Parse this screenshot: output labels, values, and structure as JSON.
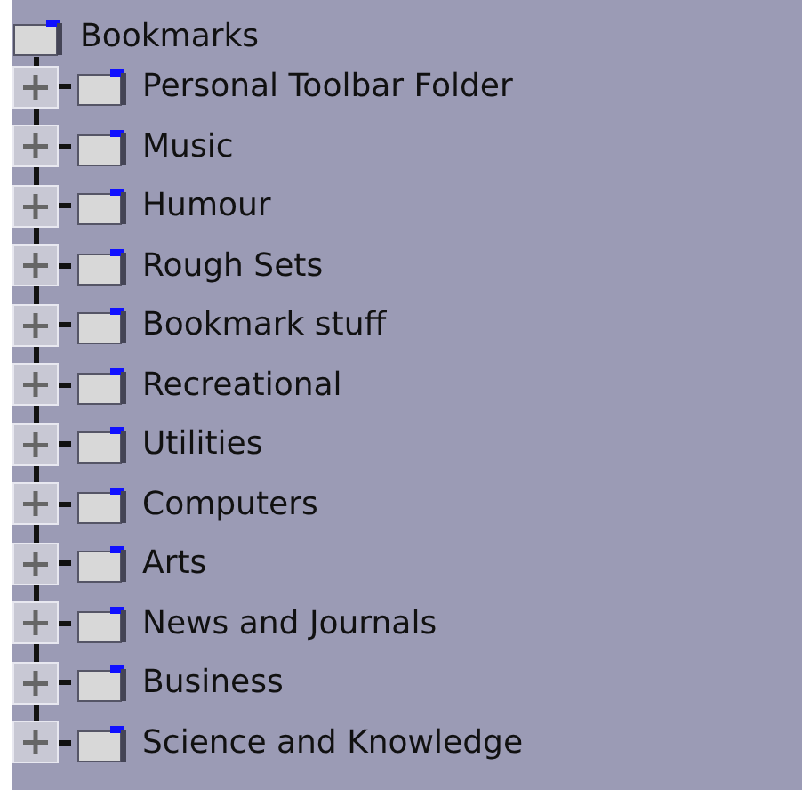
{
  "tree": {
    "label": "Bookmarks",
    "children": [
      {
        "label": "Personal Toolbar Folder",
        "expanded": false
      },
      {
        "label": "Music",
        "expanded": false
      },
      {
        "label": "Humour",
        "expanded": false
      },
      {
        "label": "Rough Sets",
        "expanded": false
      },
      {
        "label": "Bookmark stuff",
        "expanded": false
      },
      {
        "label": "Recreational",
        "expanded": false
      },
      {
        "label": "Utilities",
        "expanded": false
      },
      {
        "label": "Computers",
        "expanded": false
      },
      {
        "label": "Arts",
        "expanded": false
      },
      {
        "label": "News and Journals",
        "expanded": false
      },
      {
        "label": "Business",
        "expanded": false
      },
      {
        "label": "Science and Knowledge",
        "expanded": false
      }
    ]
  }
}
